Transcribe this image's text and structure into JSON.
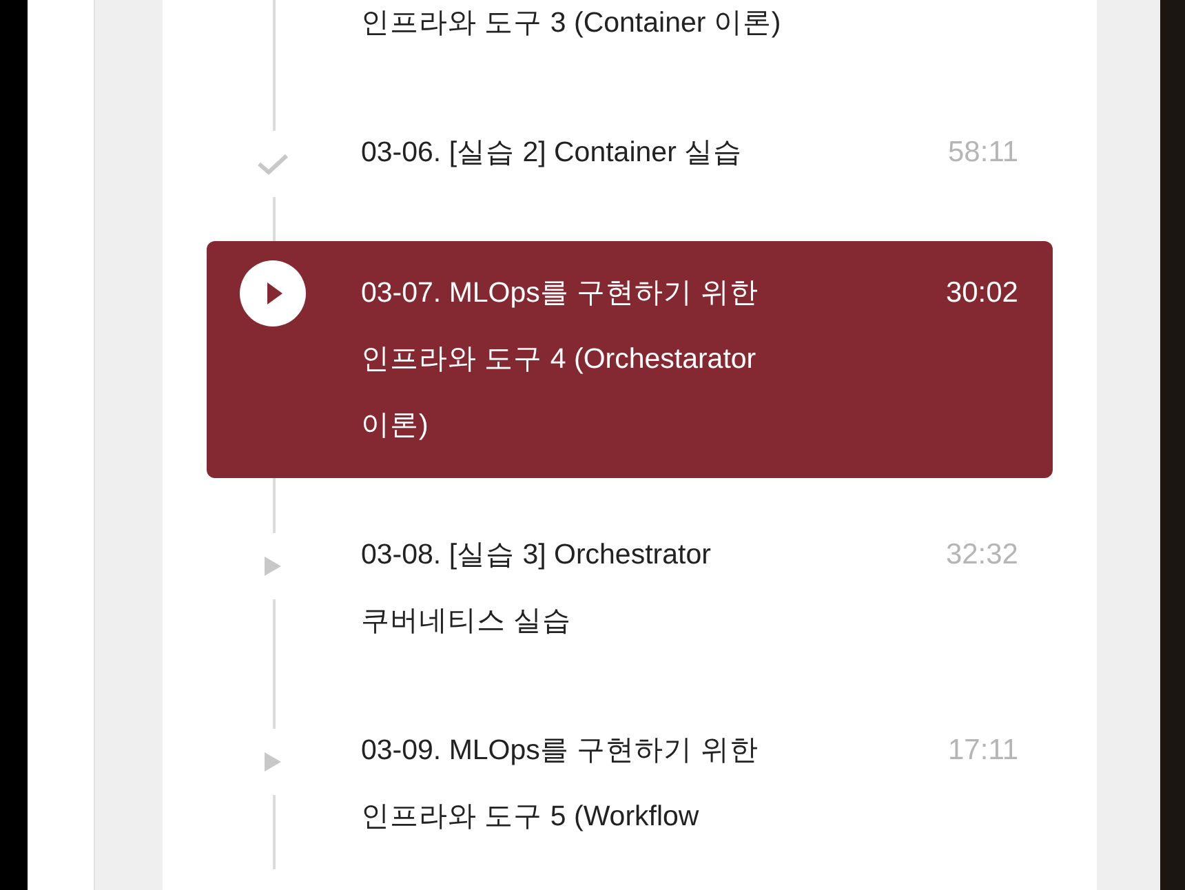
{
  "lectures": [
    {
      "kind": "continued",
      "title": "인프라와 도구 3 (Container 이론)",
      "selected": false
    },
    {
      "kind": "done",
      "title": "03-06. [실습 2] Container 실습",
      "time": "58:11",
      "selected": false
    },
    {
      "kind": "current",
      "title": "03-07. MLOps를 구현하기 위한 인프라와 도구 4 (Orchestarator 이론)",
      "time": "30:02",
      "selected": true
    },
    {
      "kind": "pending",
      "title": "03-08. [실습 3] Orchestrator 쿠버네티스 실습",
      "time": "32:32",
      "selected": false
    },
    {
      "kind": "pending",
      "title": "03-09. MLOps를 구현하기 위한 인프라와 도구 5 (Workflow",
      "time": "17:11",
      "selected": false
    }
  ]
}
